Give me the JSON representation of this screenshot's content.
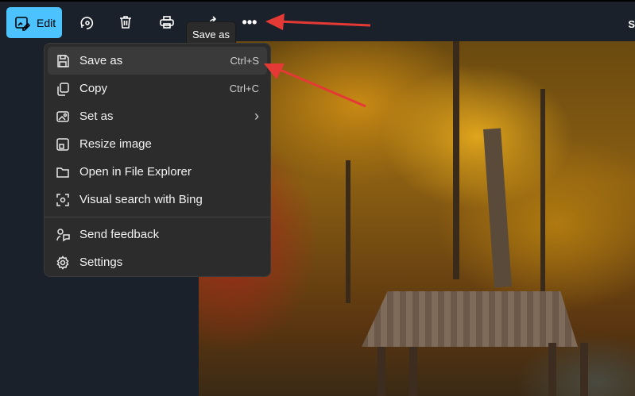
{
  "toolbar": {
    "edit_label": "Edit",
    "cut_text": "S"
  },
  "tooltip": "Save as",
  "menu": {
    "items": [
      {
        "label": "Save as",
        "shortcut": "Ctrl+S",
        "icon": "save-icon"
      },
      {
        "label": "Copy",
        "shortcut": "Ctrl+C",
        "icon": "copy-icon"
      },
      {
        "label": "Set as",
        "shortcut": "›",
        "icon": "set-as-icon"
      },
      {
        "label": "Resize image",
        "icon": "resize-icon"
      },
      {
        "label": "Open in File Explorer",
        "icon": "folder-icon"
      },
      {
        "label": "Visual search with Bing",
        "icon": "visual-search-icon"
      },
      {
        "label": "Send feedback",
        "icon": "feedback-icon"
      },
      {
        "label": "Settings",
        "icon": "gear-icon"
      }
    ]
  },
  "colors": {
    "accent": "#4cc2ff",
    "arrow": "#e53935"
  }
}
